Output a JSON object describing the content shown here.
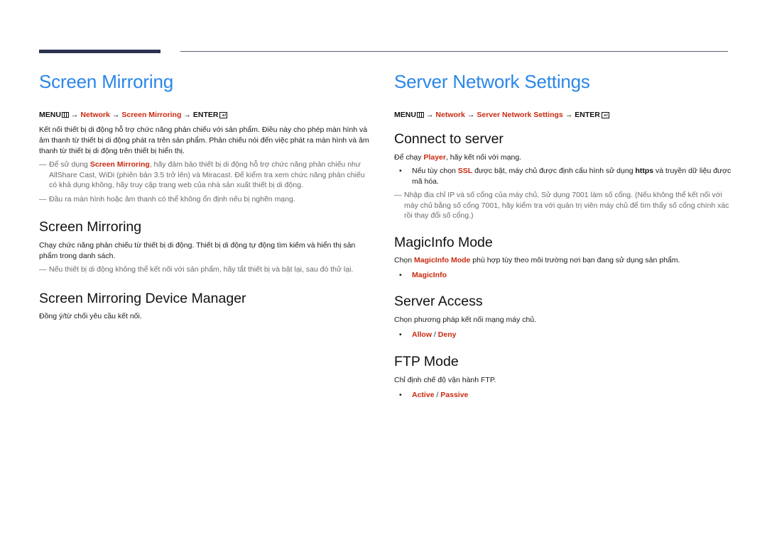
{
  "colors": {
    "title_blue": "#2a86e8",
    "highlight_red": "#c8290f",
    "note_gray": "#6a6a6a",
    "rule_dark": "#2b3350"
  },
  "icons": {
    "menu": "menu-icon",
    "enter": "enter-icon",
    "note": "note-dash-icon",
    "bullet": "bullet-icon"
  },
  "left": {
    "title": "Screen Mirroring",
    "menu_path": {
      "menu": "MENU",
      "arrow": "→",
      "network": "Network",
      "item": "Screen Mirroring",
      "enter": "ENTER"
    },
    "intro": "Kết nối thiết bị di động hỗ trợ chức năng phản chiếu với sản phẩm. Điều này cho phép màn hình và âm thanh từ thiết bị di động phát ra trên sản phẩm. Phản chiếu nói đến việc phát ra màn hình và âm thanh từ thiết bị di động trên thiết bị hiển thị.",
    "note1": {
      "prefix": "Để sử dụng ",
      "hl": "Screen Mirroring",
      "suffix": ", hãy đảm bảo thiết bị di động hỗ trợ chức năng phản chiếu như AllShare Cast, WiDi (phiên bản 3.5 trở lên) và Miracast. Để kiểm tra xem chức năng phản chiếu có khả dụng không, hãy truy cập trang web của nhà sản xuất thiết bị di động."
    },
    "note2": "Đầu ra màn hình hoặc âm thanh có thể không ổn định nếu bị nghẽn mạng.",
    "sections": [
      {
        "heading": "Screen Mirroring",
        "text": "Chạy chức năng phản chiếu từ thiết bị di động. Thiết bị di động tự động tìm kiếm và hiển thị sản phẩm trong danh sách.",
        "note": "Nếu thiết bị di động không thể kết nối với sản phẩm, hãy tắt thiết bị và bật lại, sau đó thử lại."
      },
      {
        "heading": "Screen Mirroring Device Manager",
        "text": "Đồng ý/từ chối yêu cầu kết nối."
      }
    ]
  },
  "right": {
    "title": "Server Network Settings",
    "menu_path": {
      "menu": "MENU",
      "arrow": "→",
      "network": "Network",
      "item": "Server Network Settings",
      "enter": "ENTER"
    },
    "connect": {
      "heading": "Connect to server",
      "text_prefix": "Để chạy ",
      "text_hl": "Player",
      "text_suffix": ", hãy kết nối với mạng.",
      "bullet": {
        "prefix": "Nếu tùy chọn ",
        "hl": "SSL",
        "mid": " được bật, máy chủ được định cấu hình sử dụng ",
        "bold": "https",
        "suffix": " và truyền dữ liệu được mã hóa."
      },
      "note": "Nhập địa chỉ IP và số cổng của máy chủ. Sử dụng 7001 làm số cổng. (Nếu không thể kết nối với máy chủ bằng số cổng 7001, hãy kiểm tra với quản trị viên máy chủ để tìm thấy số cổng chính xác rồi thay đổi số cổng.)"
    },
    "magicinfo": {
      "heading": "MagicInfo Mode",
      "text_prefix": "Chọn ",
      "text_hl": "MagicInfo Mode",
      "text_suffix": " phù hợp tùy theo môi trường nơi bạn đang sử dụng sản phẩm.",
      "options": [
        "MagicInfo"
      ]
    },
    "access": {
      "heading": "Server Access",
      "text": "Chọn phương pháp kết nối mạng máy chủ.",
      "options": [
        "Allow",
        "Deny"
      ]
    },
    "ftp": {
      "heading": "FTP Mode",
      "text": "Chỉ định chế độ vận hành FTP.",
      "options": [
        "Active",
        "Passive"
      ]
    },
    "bullet_char": "•",
    "dash_char": "—",
    "slash": " / "
  }
}
